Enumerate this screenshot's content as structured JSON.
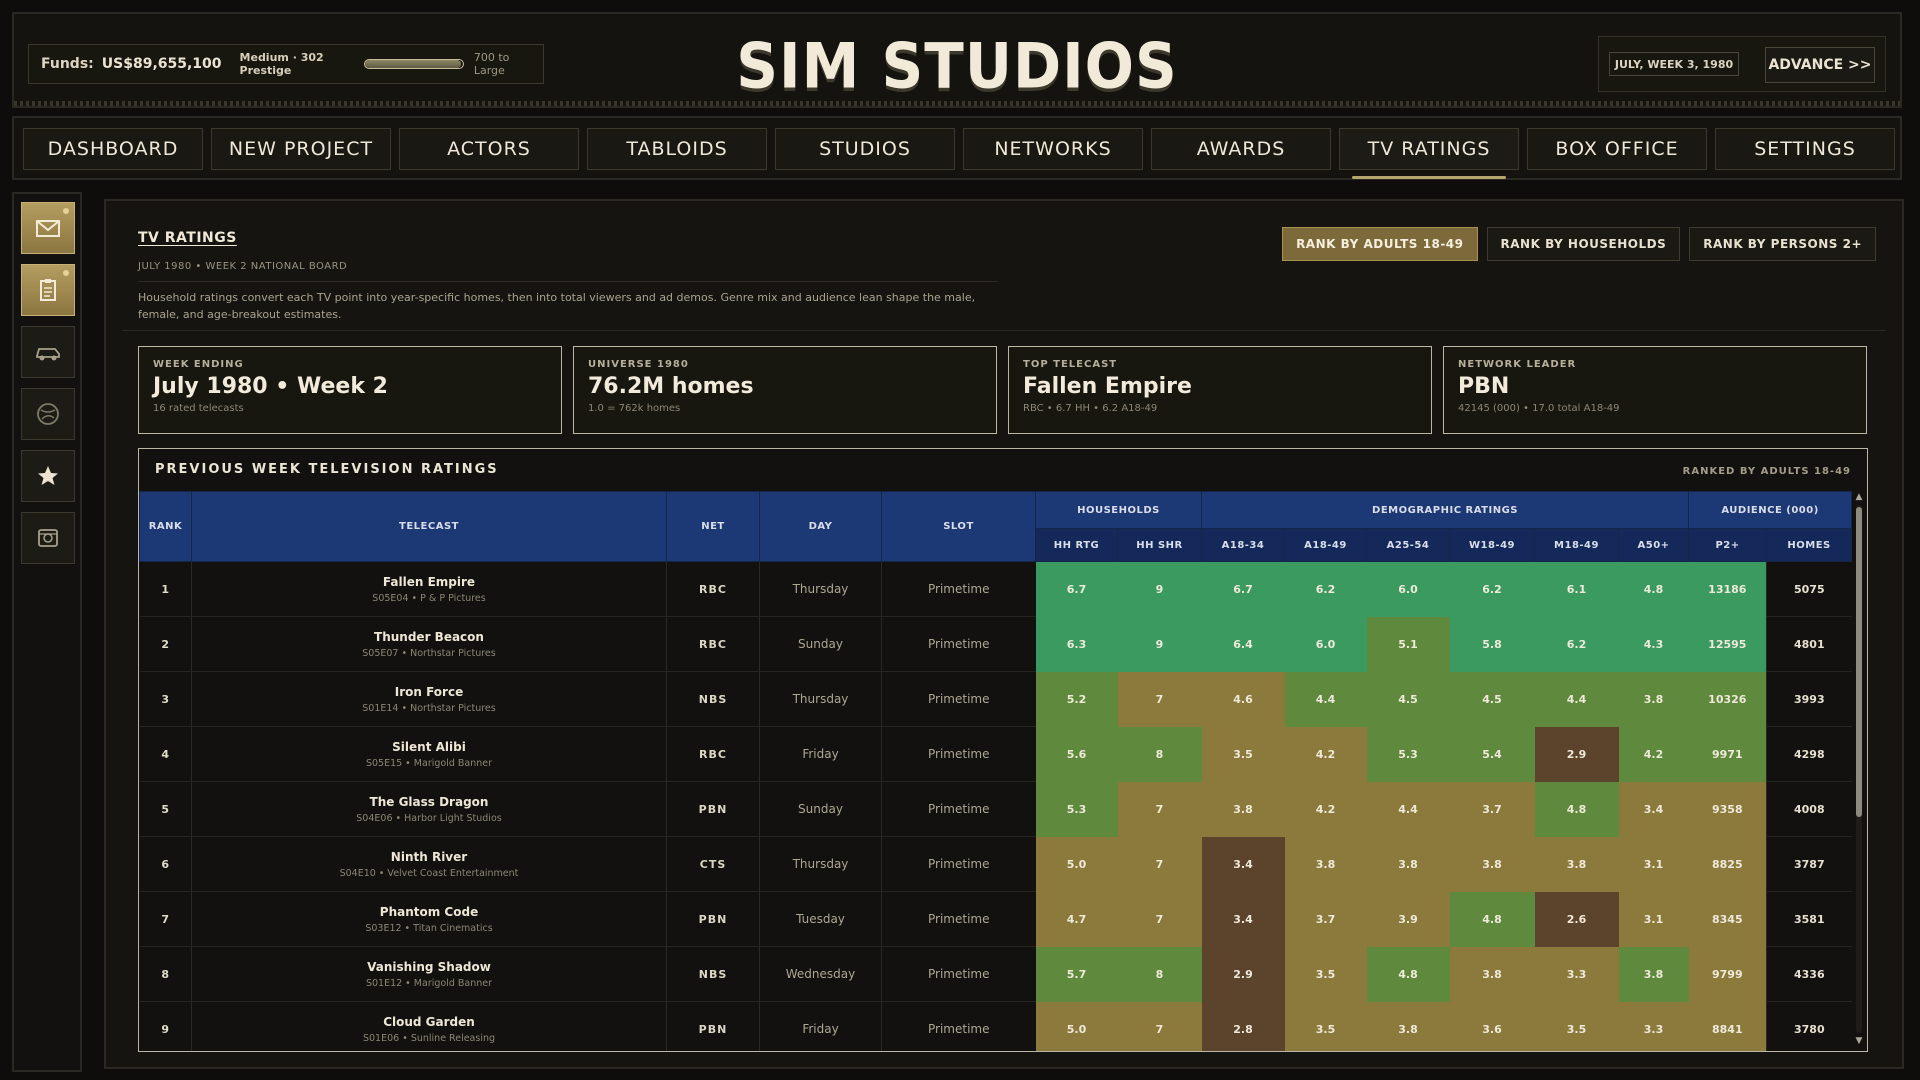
{
  "header": {
    "funds_label": "Funds:",
    "funds_value": "US$89,655,100",
    "prestige_label": "Medium · 302 Prestige",
    "prestige_progress": 0.98,
    "prestige_next": "700 to Large",
    "logo": "SIM STUDIOS",
    "date": "JULY, WEEK 3, 1980",
    "advance_label": "ADVANCE >>"
  },
  "nav": {
    "tabs": [
      "DASHBOARD",
      "NEW PROJECT",
      "ACTORS",
      "TABLOIDS",
      "STUDIOS",
      "NETWORKS",
      "AWARDS",
      "TV RATINGS",
      "BOX OFFICE",
      "SETTINGS"
    ],
    "active": "TV RATINGS"
  },
  "sidebar": {
    "icons": [
      "mail-icon",
      "clipboard-icon",
      "car-icon",
      "globe-icon",
      "star-icon",
      "film-reel-icon"
    ]
  },
  "panel": {
    "title": "TV RATINGS",
    "subtitle": "JULY 1980 • WEEK 2 NATIONAL BOARD",
    "description": "Household ratings convert each TV point into year-specific homes, then into total viewers and ad demos. Genre mix and audience lean shape the male, female, and age-breakout estimates.",
    "rank_buttons": [
      "RANK BY ADULTS 18-49",
      "RANK BY HOUSEHOLDS",
      "RANK BY PERSONS 2+"
    ],
    "active_rank": "RANK BY ADULTS 18-49"
  },
  "stats": [
    {
      "label": "WEEK ENDING",
      "value": "July 1980 • Week 2",
      "note": "16 rated telecasts"
    },
    {
      "label": "UNIVERSE 1980",
      "value": "76.2M homes",
      "note": "1.0 = 762k homes"
    },
    {
      "label": "TOP TELECAST",
      "value": "Fallen Empire",
      "note": "RBC • 6.7 HH • 6.2 A18-49"
    },
    {
      "label": "NETWORK LEADER",
      "value": "PBN",
      "note": "42145 (000) • 17.0 total A18-49"
    }
  ],
  "table": {
    "title": "PREVIOUS WEEK TELEVISION RATINGS",
    "ranked_by": "RANKED BY ADULTS 18-49",
    "headers": {
      "rank": "RANK",
      "telecast": "TELECAST",
      "net": "NET",
      "day": "DAY",
      "slot": "SLOT",
      "households": "HOUSEHOLDS",
      "demographic": "DEMOGRAPHIC RATINGS",
      "audience": "AUDIENCE (000)",
      "sub": [
        "HH RTG",
        "HH SHR",
        "A18-34",
        "A18-49",
        "A25-54",
        "W18-49",
        "M18-49",
        "A50+",
        "P2+",
        "HOMES"
      ]
    },
    "rows": [
      {
        "rank": "1",
        "title": "Fallen Empire",
        "sub": "S05E04 • P & P Pictures",
        "net": "RBC",
        "day": "Thursday",
        "slot": "Primetime",
        "vals": [
          "6.7",
          "9",
          "6.7",
          "6.2",
          "6.0",
          "6.2",
          "6.1",
          "4.8",
          "13186"
        ],
        "homes": "5075"
      },
      {
        "rank": "2",
        "title": "Thunder Beacon",
        "sub": "S05E07 • Northstar Pictures",
        "net": "RBC",
        "day": "Sunday",
        "slot": "Primetime",
        "vals": [
          "6.3",
          "9",
          "6.4",
          "6.0",
          "5.1",
          "5.8",
          "6.2",
          "4.3",
          "12595"
        ],
        "homes": "4801"
      },
      {
        "rank": "3",
        "title": "Iron Force",
        "sub": "S01E14 • Northstar Pictures",
        "net": "NBS",
        "day": "Thursday",
        "slot": "Primetime",
        "vals": [
          "5.2",
          "7",
          "4.6",
          "4.4",
          "4.5",
          "4.5",
          "4.4",
          "3.8",
          "10326"
        ],
        "homes": "3993"
      },
      {
        "rank": "4",
        "title": "Silent Alibi",
        "sub": "S05E15 • Marigold Banner",
        "net": "RBC",
        "day": "Friday",
        "slot": "Primetime",
        "vals": [
          "5.6",
          "8",
          "3.5",
          "4.2",
          "5.3",
          "5.4",
          "2.9",
          "4.2",
          "9971"
        ],
        "homes": "4298"
      },
      {
        "rank": "5",
        "title": "The Glass Dragon",
        "sub": "S04E06 • Harbor Light Studios",
        "net": "PBN",
        "day": "Sunday",
        "slot": "Primetime",
        "vals": [
          "5.3",
          "7",
          "3.8",
          "4.2",
          "4.4",
          "3.7",
          "4.8",
          "3.4",
          "9358"
        ],
        "homes": "4008"
      },
      {
        "rank": "6",
        "title": "Ninth River",
        "sub": "S04E10 • Velvet Coast Entertainment",
        "net": "CTS",
        "day": "Thursday",
        "slot": "Primetime",
        "vals": [
          "5.0",
          "7",
          "3.4",
          "3.8",
          "3.8",
          "3.8",
          "3.8",
          "3.1",
          "8825"
        ],
        "homes": "3787"
      },
      {
        "rank": "7",
        "title": "Phantom Code",
        "sub": "S03E12 • Titan Cinematics",
        "net": "PBN",
        "day": "Tuesday",
        "slot": "Primetime",
        "vals": [
          "4.7",
          "7",
          "3.4",
          "3.7",
          "3.9",
          "4.8",
          "2.6",
          "3.1",
          "8345"
        ],
        "homes": "3581"
      },
      {
        "rank": "8",
        "title": "Vanishing Shadow",
        "sub": "S01E12 • Marigold Banner",
        "net": "NBS",
        "day": "Wednesday",
        "slot": "Primetime",
        "vals": [
          "5.7",
          "8",
          "2.9",
          "3.5",
          "4.8",
          "3.8",
          "3.3",
          "3.8",
          "9799"
        ],
        "homes": "4336"
      },
      {
        "rank": "9",
        "title": "Cloud Garden",
        "sub": "S01E06 • Sunline Releasing",
        "net": "PBN",
        "day": "Friday",
        "slot": "Primetime",
        "vals": [
          "5.0",
          "7",
          "2.8",
          "3.5",
          "3.8",
          "3.6",
          "3.5",
          "3.3",
          "8841"
        ],
        "homes": "3780"
      }
    ],
    "heat_colors": [
      [
        "#3a9a60",
        "#3a9a60",
        "#3a9a60",
        "#3a9a60",
        "#3a9a60",
        "#3a9a60",
        "#3a9a60",
        "#3a9a60",
        "#3a9a60"
      ],
      [
        "#3a9a60",
        "#3a9a60",
        "#3a9a60",
        "#3a9a60",
        "#5f8a3d",
        "#3a9a60",
        "#3a9a60",
        "#3a9a60",
        "#3a9a60"
      ],
      [
        "#5f8a3d",
        "#8c7a3d",
        "#8c7a3d",
        "#5f8a3d",
        "#5f8a3d",
        "#5f8a3d",
        "#5f8a3d",
        "#5f8a3d",
        "#5f8a3d"
      ],
      [
        "#5f8a3d",
        "#5f8a3d",
        "#8c7a3d",
        "#8c7a3d",
        "#5f8a3d",
        "#5f8a3d",
        "#5c432b",
        "#5f8a3d",
        "#5f8a3d"
      ],
      [
        "#5f8a3d",
        "#8c7a3d",
        "#8c7a3d",
        "#8c7a3d",
        "#8c7a3d",
        "#8c7a3d",
        "#5f8a3d",
        "#8c7a3d",
        "#8c7a3d"
      ],
      [
        "#8c7a3d",
        "#8c7a3d",
        "#5c432b",
        "#8c7a3d",
        "#8c7a3d",
        "#8c7a3d",
        "#8c7a3d",
        "#8c7a3d",
        "#8c7a3d"
      ],
      [
        "#8c7a3d",
        "#8c7a3d",
        "#5c432b",
        "#8c7a3d",
        "#8c7a3d",
        "#5f8a3d",
        "#5c432b",
        "#8c7a3d",
        "#8c7a3d"
      ],
      [
        "#5f8a3d",
        "#5f8a3d",
        "#5c432b",
        "#8c7a3d",
        "#5f8a3d",
        "#8c7a3d",
        "#8c7a3d",
        "#5f8a3d",
        "#8c7a3d"
      ],
      [
        "#8c7a3d",
        "#8c7a3d",
        "#5c432b",
        "#8c7a3d",
        "#8c7a3d",
        "#8c7a3d",
        "#8c7a3d",
        "#8c7a3d",
        "#8c7a3d"
      ]
    ]
  }
}
